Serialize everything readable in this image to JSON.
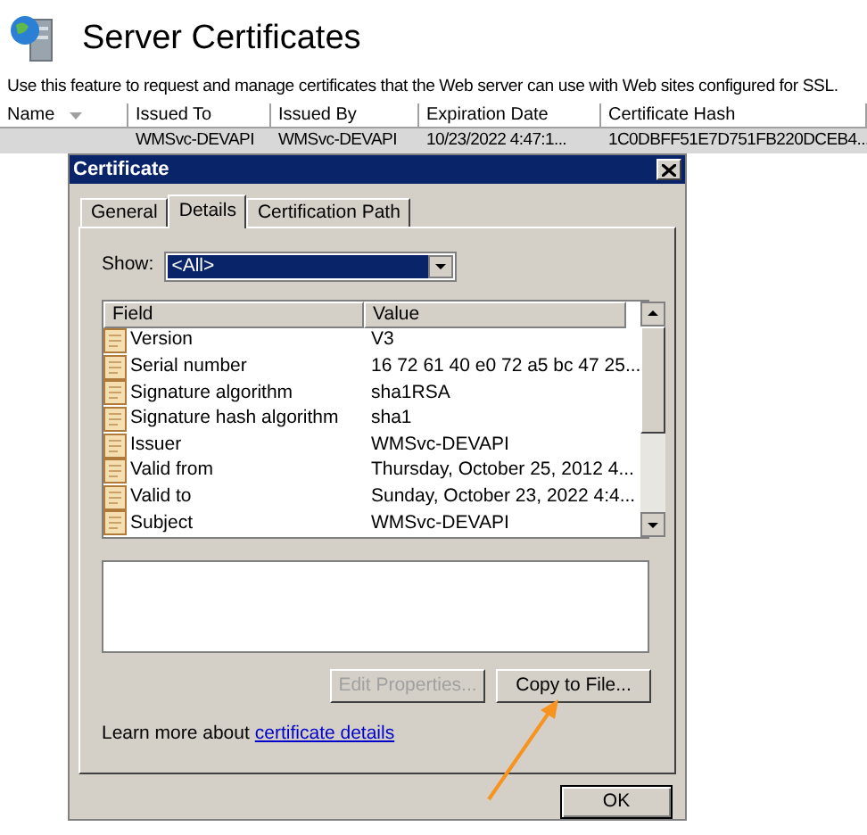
{
  "page": {
    "title": "Server Certificates",
    "description": "Use this feature to request and manage certificates that the Web server can use with Web sites configured for SSL.",
    "table": {
      "columns": [
        {
          "label": "Name",
          "sorted": true
        },
        {
          "label": "Issued To",
          "sorted": false
        },
        {
          "label": "Issued By",
          "sorted": false
        },
        {
          "label": "Expiration Date",
          "sorted": false
        },
        {
          "label": "Certificate Hash",
          "sorted": false
        }
      ],
      "rows": [
        {
          "selected": true,
          "issued_to": "WMSvc-DEVAPI",
          "issued_by": "WMSvc-DEVAPI",
          "expiration_date": "10/23/2022 4:47:1...",
          "certificate_hash": "1C0DBFF51E7D751FB220DCEB4..."
        }
      ]
    }
  },
  "dialog": {
    "title": "Certificate",
    "tabs": [
      {
        "label": "General",
        "selected": false
      },
      {
        "label": "Details",
        "selected": true
      },
      {
        "label": "Certification Path",
        "selected": false
      }
    ],
    "show": {
      "label": "Show:",
      "value": "<All>"
    },
    "fields": {
      "columns": [
        "Field",
        "Value"
      ],
      "rows": [
        {
          "field": "Version",
          "value": "V3"
        },
        {
          "field": "Serial number",
          "value": "16 72 61 40 e0 72 a5 bc 47 25..."
        },
        {
          "field": "Signature algorithm",
          "value": "sha1RSA"
        },
        {
          "field": "Signature hash algorithm",
          "value": "sha1"
        },
        {
          "field": "Issuer",
          "value": "WMSvc-DEVAPI"
        },
        {
          "field": "Valid from",
          "value": "Thursday, October 25, 2012 4..."
        },
        {
          "field": "Valid to",
          "value": "Sunday, October 23, 2022 4:4..."
        },
        {
          "field": "Subject",
          "value": "WMSvc-DEVAPI"
        }
      ]
    },
    "buttons": [
      {
        "label": "Edit Properties...",
        "disabled": true
      },
      {
        "label": "Copy to File...",
        "disabled": false
      }
    ],
    "learn_more": {
      "text": "Learn more about",
      "link": "certificate details"
    },
    "ok": "OK"
  }
}
